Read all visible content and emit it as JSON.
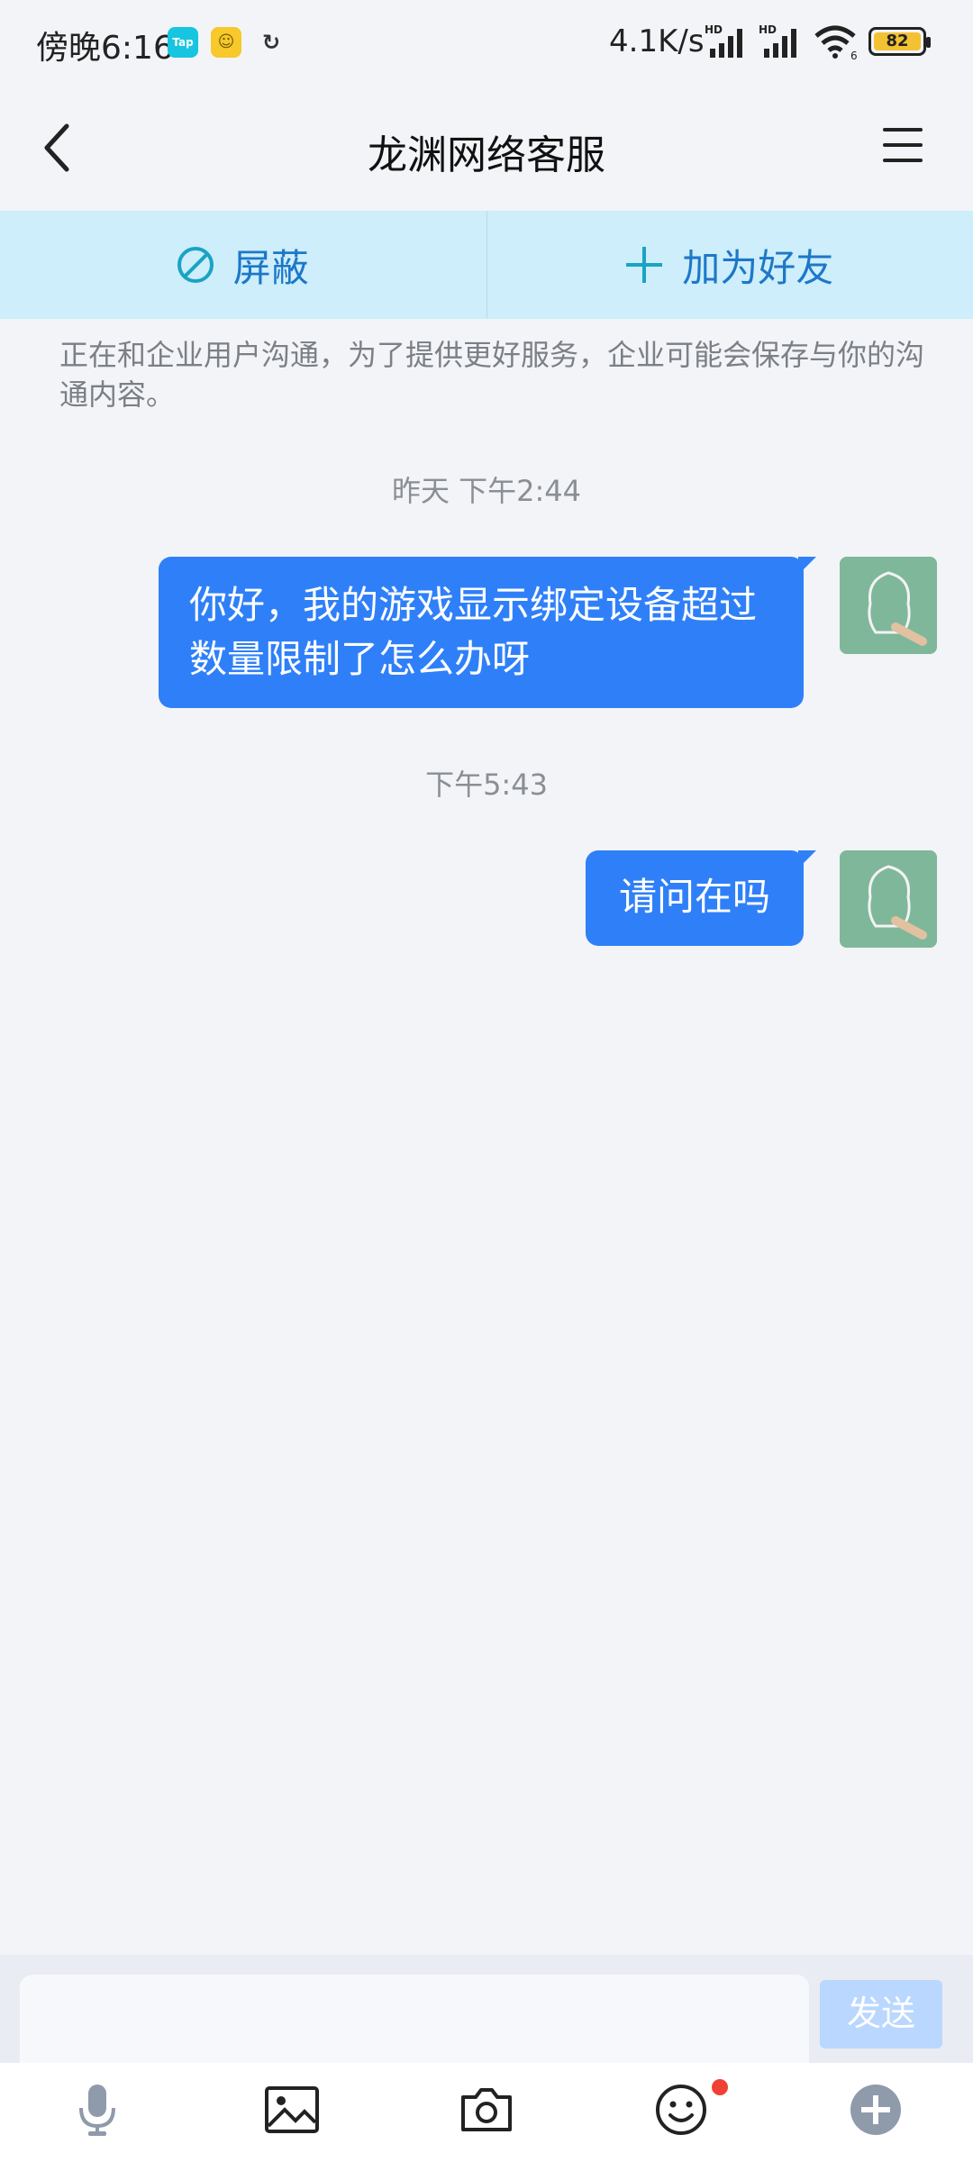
{
  "status_bar": {
    "time": "傍晚6:16",
    "app_badges": [
      "Tap"
    ],
    "net_speed": "4.1K/s",
    "battery": "82",
    "signal_labels": [
      "HD",
      "HD"
    ],
    "wifi_label": "6"
  },
  "header": {
    "title": "龙渊网络客服",
    "back_icon": "chevron-left-icon",
    "menu_icon": "hamburger-menu-icon"
  },
  "actions": {
    "block_label": "屏蔽",
    "add_friend_label": "加为好友"
  },
  "notice": "正在和企业用户沟通，为了提供更好服务，企业可能会保存与你的沟通内容。",
  "messages": [
    {
      "timestamp": "昨天 下午2:44",
      "text": "你好，我的游戏显示绑定设备超过数量限制了怎么办呀"
    },
    {
      "timestamp": "下午5:43",
      "text": "请问在吗"
    }
  ],
  "input": {
    "placeholder": "",
    "send_label": "发送"
  },
  "toolbar": {
    "icons": [
      "microphone-icon",
      "image-icon",
      "camera-icon",
      "emoji-icon",
      "plus-icon"
    ]
  },
  "colors": {
    "bubble": "#2f80f8",
    "action_bar": "#cdeefa",
    "background": "#f2f4f8"
  }
}
